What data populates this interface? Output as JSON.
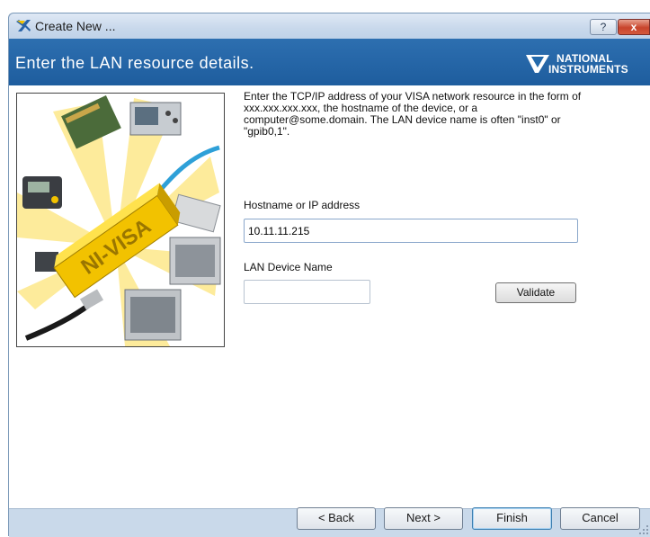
{
  "window": {
    "title": "Create New ...",
    "help_label": "?",
    "close_label": "x"
  },
  "header": {
    "title": "Enter the LAN resource details.",
    "logo_line1": "NATIONAL",
    "logo_line2": "INSTRUMENTS"
  },
  "graphic": {
    "brand_text": "NI-VISA"
  },
  "form": {
    "instructions": "Enter the TCP/IP address of your VISA network resource in the form of xxx.xxx.xxx.xxx, the hostname of the device, or a computer@some.domain. The LAN device name is often \"inst0\" or \"gpib0,1\".",
    "hostname_label": "Hostname or IP address",
    "hostname_value": "10.11.11.215",
    "lan_device_label": "LAN Device Name",
    "lan_device_value": "",
    "validate_label": "Validate"
  },
  "footer": {
    "back_label": "< Back",
    "next_label": "Next >",
    "finish_label": "Finish",
    "cancel_label": "Cancel"
  },
  "colors": {
    "header_blue": "#2369ab",
    "window_frame": "#c9d9ea",
    "ni_yellow": "#f2c200"
  }
}
